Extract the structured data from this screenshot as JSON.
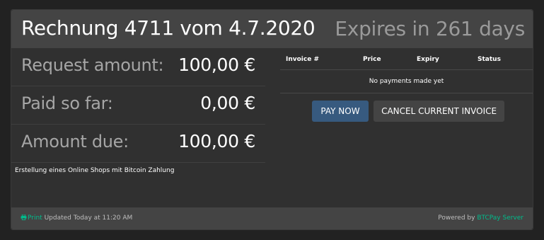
{
  "header": {
    "title": "Rechnung 4711 vom 4.7.2020",
    "expires": "Expires in 261 days"
  },
  "summary": {
    "rows": [
      {
        "label": "Request amount:",
        "value": "100,00 €"
      },
      {
        "label": "Paid so far:",
        "value": "0,00 €"
      },
      {
        "label": "Amount due:",
        "value": "100,00 €"
      }
    ],
    "description": "Erstellung eines Online Shops mit Bitcoin Zahlung"
  },
  "payments": {
    "columns": [
      "Invoice #",
      "Price",
      "Expiry",
      "Status"
    ],
    "empty_message": "No payments made yet"
  },
  "actions": {
    "pay_now": "PAY NOW",
    "cancel": "CANCEL CURRENT INVOICE"
  },
  "footer": {
    "print_label": "Print",
    "updated_text": "Updated Today at 11:20 AM",
    "powered_by_prefix": "Powered by",
    "powered_by_link": "BTCPay Server"
  },
  "colors": {
    "accent_link": "#00bc8c",
    "primary_button": "#375a7f"
  },
  "icons": {
    "print": "print-icon"
  }
}
